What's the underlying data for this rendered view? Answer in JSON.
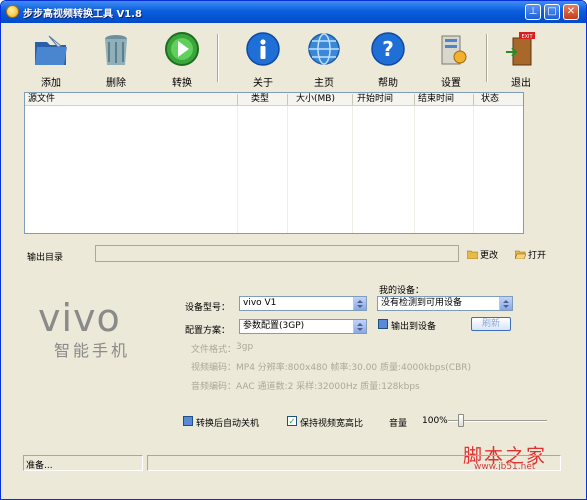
{
  "window": {
    "title": "步步高视频转换工具 V1.8",
    "buttons": [
      "⊥",
      "□",
      "✕"
    ]
  },
  "toolbar": {
    "add": "添加",
    "delete": "删除",
    "convert": "转换",
    "about": "关于",
    "home": "主页",
    "help": "帮助",
    "settings": "设置",
    "exit": "退出"
  },
  "list": {
    "columns": [
      "源文件",
      "类型",
      "大小(MB)",
      "开始时间",
      "结束时间",
      "状态"
    ]
  },
  "output": {
    "label": "输出目录",
    "value": "",
    "change": "更改",
    "open": "打开"
  },
  "logo": {
    "brand": "vivo",
    "tagline": "智能手机"
  },
  "device": {
    "my_device_label": "我的设备：",
    "my_device_value": "没有检测到可用设备",
    "model_label": "设备型号：",
    "model_value": "vivo V1",
    "config_label": "配置方案：",
    "config_value": "参数配置(3GP)",
    "output_to_device": "输出到设备",
    "refresh": "刷新"
  },
  "info": {
    "format_label": "文件格式：",
    "format_value": "3gp",
    "video_label": "视频编码：",
    "video_value": "MP4  分辨率:800x480  帧率:30.00  质量:4000kbps(CBR)",
    "audio_label": "音频编码：",
    "audio_value": "AAC  通道数:2  采样:32000Hz  质量:128kbps"
  },
  "options": {
    "shutdown": "转换后自动关机",
    "keep_ratio": "保持视频宽高比",
    "volume_label": "音量",
    "volume_value": "100%",
    "volume_level": 0.13
  },
  "status": {
    "text": "准备..."
  },
  "watermark": {
    "text": "脚本之家",
    "url": "www.jb51.net"
  },
  "colors": {
    "title_bar": "#0a5fde",
    "window_bg": "#ece9d8",
    "watermark": "#e03030"
  }
}
